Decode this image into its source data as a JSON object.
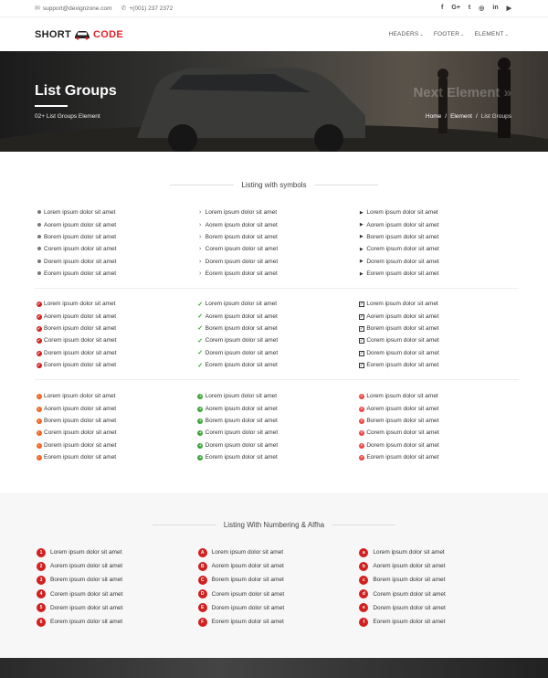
{
  "topbar": {
    "email": "support@dexignzone.com",
    "phone": "+(001) 237 2372",
    "social_icons": [
      "facebook-icon",
      "google-plus-icon",
      "twitter-icon",
      "instagram-icon",
      "linkedin-icon",
      "youtube-icon"
    ],
    "social_glyphs": [
      "f",
      "G+",
      "t",
      "◎",
      "in",
      "▶"
    ]
  },
  "header": {
    "logo_short": "SHORT",
    "logo_code": "CODE",
    "nav": [
      "HEADERS",
      "FOOTER",
      "ELEMENT"
    ]
  },
  "hero": {
    "title": "List Groups",
    "subtitle": "02+ List Groups Element",
    "next": "Next Element »",
    "crumbs": [
      "Home",
      "Element",
      "List Groups"
    ]
  },
  "section1": {
    "title": "Listing with symbols",
    "groups": [
      [
        [
          "Lorem ipsum dolor sit amet",
          "Aorem ipsum dolor sit amet",
          "Borem ipsum dolor sit amet",
          "Corem ipsum dolor sit amet",
          "Dorem ipsum dolor sit amet",
          "Eorem ipsum dolor sit amet"
        ],
        [
          "Lorem ipsum dolor sit amet",
          "Aorem ipsum dolor sit amet",
          "Borem ipsum dolor sit amet",
          "Corem ipsum dolor sit amet",
          "Dorem ipsum dolor sit amet",
          "Eorem ipsum dolor sit amet"
        ],
        [
          "Lorem ipsum dolor sit amet",
          "Aorem ipsum dolor sit amet",
          "Borem ipsum dolor sit amet",
          "Corem ipsum dolor sit amet",
          "Dorem ipsum dolor sit amet",
          "Eorem ipsum dolor sit amet"
        ]
      ],
      [
        [
          "Lorem ipsum dolor sit amet",
          "Aorem ipsum dolor sit amet",
          "Borem ipsum dolor sit amet",
          "Corem ipsum dolor sit amet",
          "Dorem ipsum dolor sit amet",
          "Eorem ipsum dolor sit amet"
        ],
        [
          "Lorem ipsum dolor sit amet",
          "Aorem ipsum dolor sit amet",
          "Borem ipsum dolor sit amet",
          "Corem ipsum dolor sit amet",
          "Dorem ipsum dolor sit amet",
          "Eorem ipsum dolor sit amet"
        ],
        [
          "Lorem ipsum dolor sit amet",
          "Aorem ipsum dolor sit amet",
          "Borem ipsum dolor sit amet",
          "Corem ipsum dolor sit amet",
          "Dorem ipsum dolor sit amet",
          "Eorem ipsum dolor sit amet"
        ]
      ],
      [
        [
          "Lorem ipsum dolor sit amet",
          "Aorem ipsum dolor sit amet",
          "Borem ipsum dolor sit amet",
          "Corem ipsum dolor sit amet",
          "Dorem ipsum dolor sit amet",
          "Eorem ipsum dolor sit amet"
        ],
        [
          "Lorem ipsum dolor sit amet",
          "Aorem ipsum dolor sit amet",
          "Borem ipsum dolor sit amet",
          "Corem ipsum dolor sit amet",
          "Dorem ipsum dolor sit amet",
          "Eorem ipsum dolor sit amet"
        ],
        [
          "Lorem ipsum dolor sit amet",
          "Aorem ipsum dolor sit amet",
          "Borem ipsum dolor sit amet",
          "Corem ipsum dolor sit amet",
          "Dorem ipsum dolor sit amet",
          "Eorem ipsum dolor sit amet"
        ]
      ]
    ],
    "markers": [
      [
        "dot-icon",
        "chevron-right-icon",
        "triangle-right-icon"
      ],
      [
        "red-check-circle-icon",
        "green-check-icon",
        "checkbox-checked-icon"
      ],
      [
        "orange-arrow-circle-icon",
        "green-plus-circle-icon",
        "red-x-circle-icon"
      ]
    ]
  },
  "section2": {
    "title": "Listing With Numbering & Alfha",
    "columns": [
      {
        "badges": [
          "1",
          "2",
          "3",
          "4",
          "5",
          "6"
        ],
        "items": [
          "Lorem ipsum dolor sit amet",
          "Aorem ipsum dolor sit amet",
          "Borem ipsum dolor sit amet",
          "Corem ipsum dolor sit amet",
          "Dorem ipsum dolor sit amet",
          "Eorem ipsum dolor sit amet"
        ]
      },
      {
        "badges": [
          "A",
          "B",
          "C",
          "D",
          "E",
          "F"
        ],
        "items": [
          "Lorem ipsum dolor sit amet",
          "Aorem ipsum dolor sit amet",
          "Borem ipsum dolor sit amet",
          "Corem ipsum dolor sit amet",
          "Dorem ipsum dolor sit amet",
          "Eorem ipsum dolor sit amet"
        ]
      },
      {
        "badges": [
          "a",
          "b",
          "c",
          "d",
          "e",
          "f"
        ],
        "items": [
          "Lorem ipsum dolor sit amet",
          "Aorem ipsum dolor sit amet",
          "Borem ipsum dolor sit amet",
          "Corem ipsum dolor sit amet",
          "Dorem ipsum dolor sit amet",
          "Eorem ipsum dolor sit amet"
        ]
      }
    ]
  },
  "colors": {
    "accent": "#e3202b",
    "badge": "#d0201f",
    "green": "#3aa636",
    "orange": "#f26522"
  }
}
